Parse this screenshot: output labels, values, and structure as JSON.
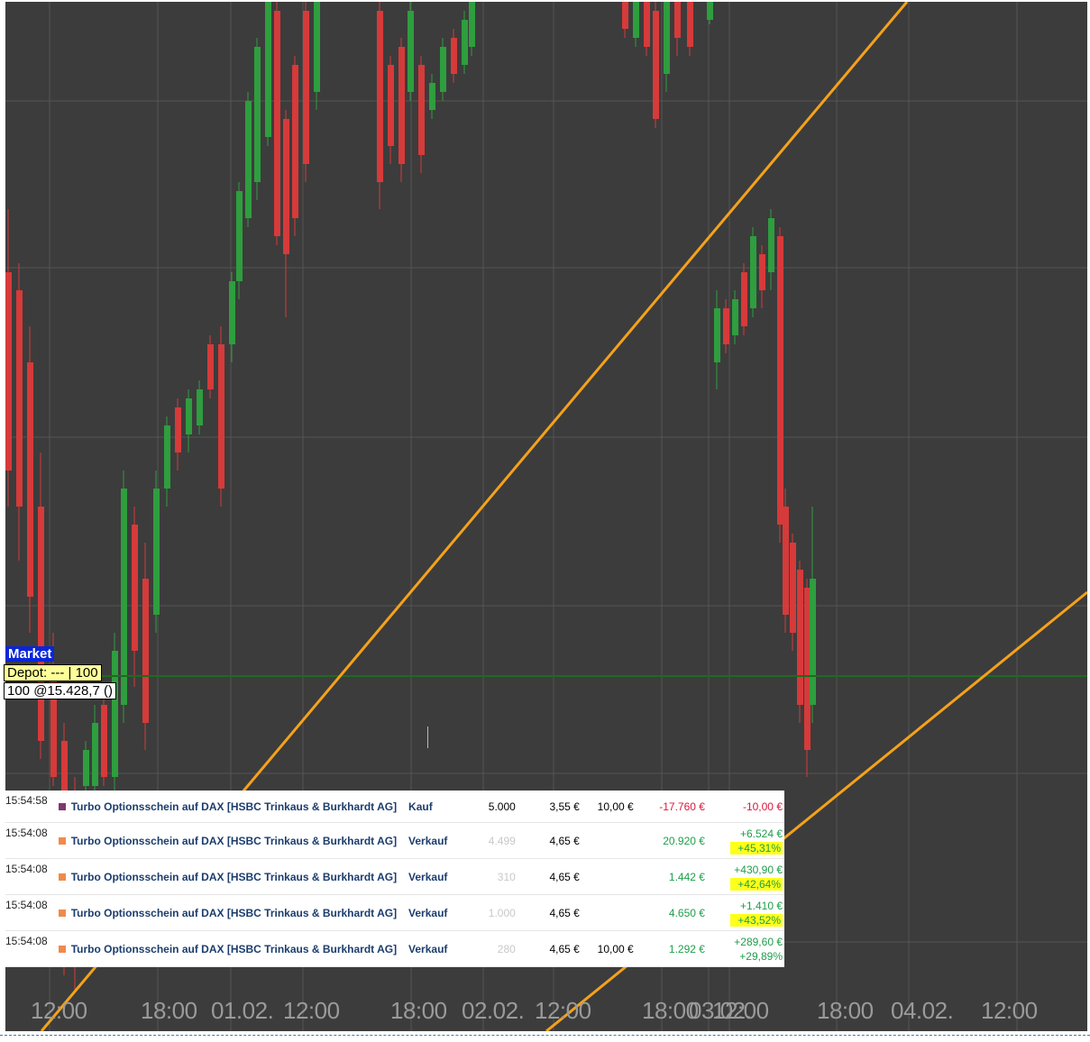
{
  "chart": {
    "x_axis_labels": [
      "12:00",
      "18:00",
      "01.02.",
      "12:00",
      "18:00",
      "02.02.",
      "12:00",
      "18:00",
      "03.02.",
      "12:00",
      "18:00",
      "04.02.",
      "12:00"
    ],
    "colors": {
      "background": "#3c3c3c",
      "grid": "#555555",
      "up": "#2e9e3e",
      "down": "#d63a3a",
      "trendline": "#f5a21a",
      "position_line": "#1d6b1d"
    }
  },
  "position_tags": {
    "market": "Market",
    "depot": "Depot: --- | 100",
    "order": "100 @15.428,7 ()"
  },
  "orders": [
    {
      "time": "15:54:58",
      "color": "#7b3a6e",
      "name": "Turbo Optionsschein auf DAX [HSBC Trinkaus & Burkhardt AG]",
      "side": "Kauf",
      "qty": "5.000",
      "price": "3,55 €",
      "fee": "10,00 €",
      "total": "-17.760 €",
      "pl_abs": "-10,00 €",
      "pl_pct": ""
    },
    {
      "time": "15:54:08",
      "color": "#f08a4b",
      "name": "Turbo Optionsschein auf DAX [HSBC Trinkaus & Burkhardt AG]",
      "side": "Verkauf",
      "qty": "4.499",
      "price": "4,65 €",
      "fee": "",
      "total": "20.920 €",
      "pl_abs": "+6.524 €",
      "pl_pct": "+45,31%"
    },
    {
      "time": "15:54:08",
      "color": "#f08a4b",
      "name": "Turbo Optionsschein auf DAX [HSBC Trinkaus & Burkhardt AG]",
      "side": "Verkauf",
      "qty": "310",
      "price": "4,65 €",
      "fee": "",
      "total": "1.442 €",
      "pl_abs": "+430,90 €",
      "pl_pct": "+42,64%"
    },
    {
      "time": "15:54:08",
      "color": "#f08a4b",
      "name": "Turbo Optionsschein auf DAX [HSBC Trinkaus & Burkhardt AG]",
      "side": "Verkauf",
      "qty": "1.000",
      "price": "4,65 €",
      "fee": "",
      "total": "4.650 €",
      "pl_abs": "+1.410 €",
      "pl_pct": "+43,52%"
    },
    {
      "time": "15:54:08",
      "color": "#f08a4b",
      "name": "Turbo Optionsschein auf DAX [HSBC Trinkaus & Burkhardt AG]",
      "side": "Verkauf",
      "qty": "280",
      "price": "4,65 €",
      "fee": "10,00 €",
      "total": "1.292 €",
      "pl_abs": "+289,60 €",
      "pl_pct": "+29,89%"
    }
  ]
}
